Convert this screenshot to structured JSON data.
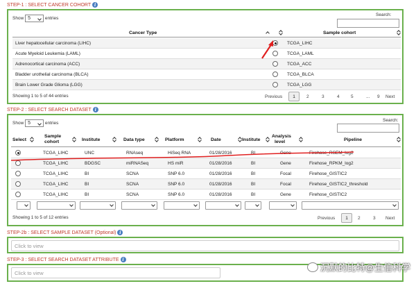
{
  "step1": {
    "title": "STEP-1 : SELECT CANCER COHORT",
    "show_label": "Show",
    "entries_value": "5",
    "entries_label": "entries",
    "search_label": "Search:",
    "col_cancer": "Cancer Type",
    "col_cohort": "Sample cohort",
    "rows": [
      {
        "cancer": "Liver hepatocellular carcinoma (LIHC)",
        "cohort": "TCGA_LIHC",
        "selected": true
      },
      {
        "cancer": "Acute Myeloid Leukemia (LAML)",
        "cohort": "TCGA_LAML",
        "selected": false
      },
      {
        "cancer": "Adrenocortical carcinoma (ACC)",
        "cohort": "TCGA_ACC",
        "selected": false
      },
      {
        "cancer": "Bladder urothelial carcinoma (BLCA)",
        "cohort": "TCGA_BLCA",
        "selected": false
      },
      {
        "cancer": "Brain Lower Grade Glioma (LGG)",
        "cohort": "TCGA_LGG",
        "selected": false
      }
    ],
    "info": "Showing 1 to 5 of 44 entries",
    "previous": "Previous",
    "pages": [
      "1",
      "2",
      "3",
      "4",
      "5",
      "...",
      "9"
    ],
    "next": "Next"
  },
  "step2": {
    "title": "STEP-2 : SELECT SEARCH DATASET",
    "show_label": "Show",
    "entries_value": "5",
    "entries_label": "entries",
    "search_label": "Search:",
    "headers": {
      "select": "Select",
      "sample_cohort_1": "Sample",
      "sample_cohort_2": "cohort",
      "institute": "Institute",
      "data_type": "Data type",
      "platform": "Platform",
      "date": "Date",
      "institute2": "Institute",
      "analysis_1": "Analysis",
      "analysis_2": "level",
      "pipeline": "Pipeline"
    },
    "rows": [
      {
        "cohort": "TCGA_LIHC",
        "institute": "UNC",
        "dtype": "RNAseq",
        "platform": "HiSeq RNA",
        "date": "01/28/2016",
        "inst2": "BI",
        "level": "Gene",
        "pipeline": "Firehose_RSEM_log2",
        "selected": true
      },
      {
        "cohort": "TCGA_LIHC",
        "institute": "BDGSC",
        "dtype": "miRNASeq",
        "platform": "HS miR",
        "date": "01/28/2016",
        "inst2": "BI",
        "level": "Gene",
        "pipeline": "Firehose_RPKM_log2",
        "selected": false
      },
      {
        "cohort": "TCGA_LIHC",
        "institute": "BI",
        "dtype": "SCNA",
        "platform": "SNP 6.0",
        "date": "01/28/2016",
        "inst2": "BI",
        "level": "Focal",
        "pipeline": "Firehose_GISTIC2",
        "selected": false
      },
      {
        "cohort": "TCGA_LIHC",
        "institute": "BI",
        "dtype": "SCNA",
        "platform": "SNP 6.0",
        "date": "01/28/2016",
        "inst2": "BI",
        "level": "Focal",
        "pipeline": "Firehose_GISTIC2_threshold",
        "selected": false
      },
      {
        "cohort": "TCGA_LIHC",
        "institute": "BI",
        "dtype": "SCNA",
        "platform": "SNP 6.0",
        "date": "01/28/2016",
        "inst2": "BI",
        "level": "Gene",
        "pipeline": "Firehose_GISTIC2",
        "selected": false
      }
    ],
    "info": "Showing 1 to 5 of 12 entries",
    "previous": "Previous",
    "pages": [
      "1",
      "2",
      "3"
    ],
    "next": "Next"
  },
  "step2b": {
    "title": "STEP-2b : SELECT SAMPLE DATASET (Optional)",
    "placeholder": "Click to view"
  },
  "step3": {
    "title": "STEP-3 : SELECT SEARCH DATASET ATTRIBUTE",
    "placeholder": "Click to view"
  },
  "watermark": "沉默的比特@生信科学",
  "colors": {
    "accent_red": "#c0392b",
    "panel_border": "#6ab04c",
    "annotation": "#e02020",
    "info_icon": "#4a7fc1"
  }
}
